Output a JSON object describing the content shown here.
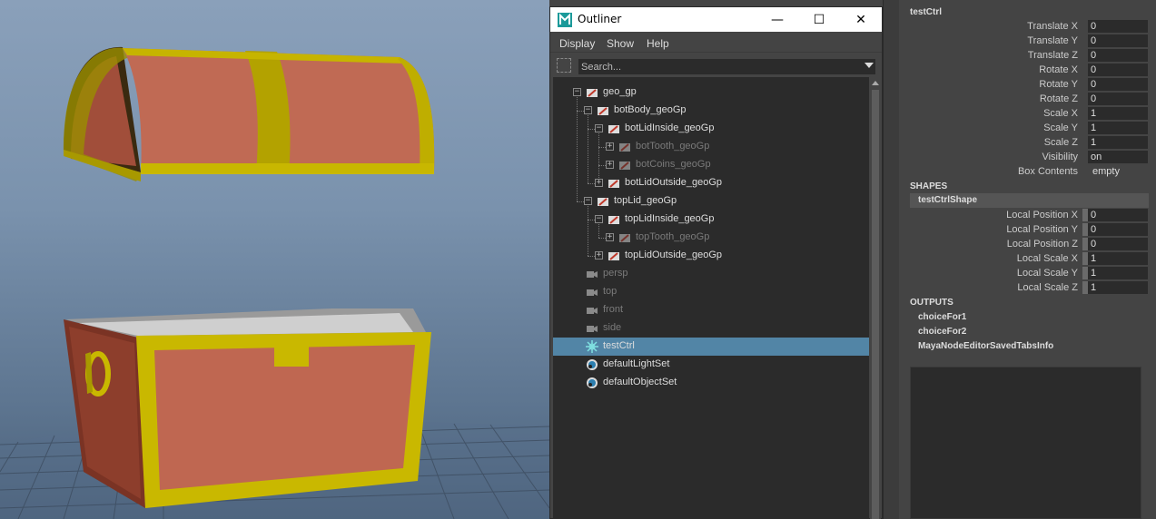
{
  "window": {
    "title": "Outliner",
    "minimize_glyph": "—",
    "maximize_glyph": "☐",
    "close_glyph": "✕"
  },
  "menu": {
    "display": "Display",
    "show": "Show",
    "help": "Help"
  },
  "search": {
    "placeholder": "Search..."
  },
  "outliner": {
    "items": [
      {
        "label": "geo_gp",
        "icon": "group-icon",
        "dim": false
      },
      {
        "label": "botBody_geoGp",
        "icon": "group-icon",
        "dim": false
      },
      {
        "label": "botLidInside_geoGp",
        "icon": "group-icon",
        "dim": false
      },
      {
        "label": "botTooth_geoGp",
        "icon": "group-icon",
        "dim": true
      },
      {
        "label": "botCoins_geoGp",
        "icon": "group-icon",
        "dim": true
      },
      {
        "label": "botLidOutside_geoGp",
        "icon": "group-icon",
        "dim": false
      },
      {
        "label": "topLid_geoGp",
        "icon": "group-icon",
        "dim": false
      },
      {
        "label": "topLidInside_geoGp",
        "icon": "group-icon",
        "dim": false
      },
      {
        "label": "topTooth_geoGp",
        "icon": "group-icon",
        "dim": true
      },
      {
        "label": "topLidOutside_geoGp",
        "icon": "group-icon",
        "dim": false
      },
      {
        "label": "persp",
        "icon": "camera-icon",
        "dim": true
      },
      {
        "label": "top",
        "icon": "camera-icon",
        "dim": true
      },
      {
        "label": "front",
        "icon": "camera-icon",
        "dim": true
      },
      {
        "label": "side",
        "icon": "camera-icon",
        "dim": true
      },
      {
        "label": "testCtrl",
        "icon": "control-icon",
        "dim": false,
        "selected": true
      },
      {
        "label": "defaultLightSet",
        "icon": "set-icon",
        "dim": false
      },
      {
        "label": "defaultObjectSet",
        "icon": "set-icon",
        "dim": false
      }
    ]
  },
  "attributes": {
    "node": "testCtrl",
    "transform": [
      {
        "name": "Translate X",
        "value": "0"
      },
      {
        "name": "Translate Y",
        "value": "0"
      },
      {
        "name": "Translate Z",
        "value": "0"
      },
      {
        "name": "Rotate X",
        "value": "0"
      },
      {
        "name": "Rotate Y",
        "value": "0"
      },
      {
        "name": "Rotate Z",
        "value": "0"
      },
      {
        "name": "Scale X",
        "value": "1"
      },
      {
        "name": "Scale Y",
        "value": "1"
      },
      {
        "name": "Scale Z",
        "value": "1"
      },
      {
        "name": "Visibility",
        "value": "on"
      },
      {
        "name": "Box Contents",
        "value": "empty"
      }
    ],
    "shapes_header": "SHAPES",
    "shape_name": "testCtrlShape",
    "shape_attrs": [
      {
        "name": "Local Position X",
        "value": "0"
      },
      {
        "name": "Local Position Y",
        "value": "0"
      },
      {
        "name": "Local Position Z",
        "value": "0"
      },
      {
        "name": "Local Scale X",
        "value": "1"
      },
      {
        "name": "Local Scale Y",
        "value": "1"
      },
      {
        "name": "Local Scale Z",
        "value": "1"
      }
    ],
    "outputs_header": "OUTPUTS",
    "outputs": [
      "choiceFor1",
      "choiceFor2",
      "MayaNodeEditorSavedTabsInfo"
    ]
  },
  "colors": {
    "selection": "#5285a6",
    "chest_wood": "#b5604a",
    "chest_trim": "#c9b800"
  }
}
